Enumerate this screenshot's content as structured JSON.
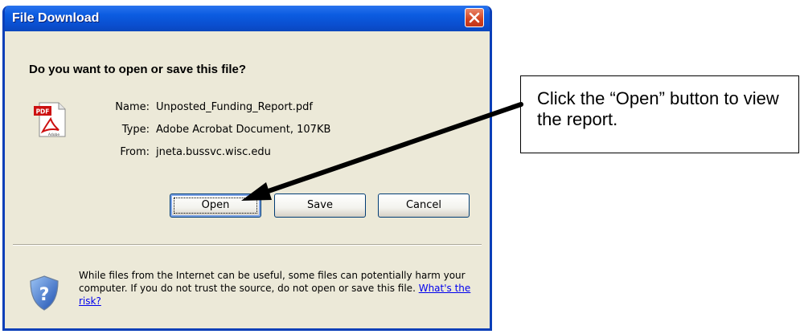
{
  "dialog": {
    "title": "File Download",
    "heading": "Do you want to open or save this file?",
    "file": {
      "icon": "pdf-file-icon",
      "name_label": "Name:",
      "name_value": "Unposted_Funding_Report.pdf",
      "type_label": "Type:",
      "type_value": "Adobe Acrobat Document, 107KB",
      "from_label": "From:",
      "from_value": "jneta.bussvc.wisc.edu"
    },
    "buttons": {
      "open": "Open",
      "save": "Save",
      "cancel": "Cancel"
    },
    "warning": {
      "text": "While files from the Internet can be useful, some files can potentially harm your computer. If you do not trust the source, do not open or save this file. ",
      "link": "What's the risk?",
      "icon": "shield-question-icon"
    },
    "colors": {
      "titlebar": "#0a4fd0",
      "body": "#ece9d8",
      "close": "#d2421f",
      "link": "#0000ee"
    }
  },
  "callout": {
    "text": "Click the “Open” button to view the report."
  }
}
